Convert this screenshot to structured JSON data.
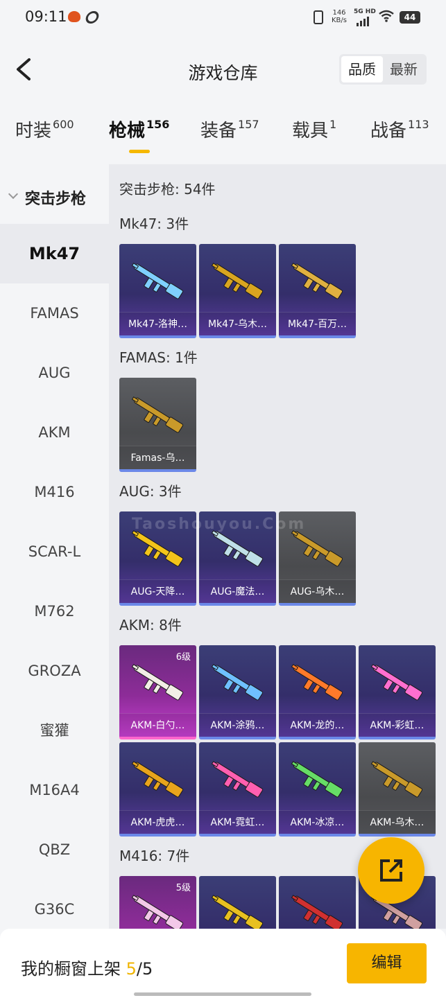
{
  "status_bar": {
    "time": "09:11",
    "speed_value": "146",
    "speed_unit": "KB/s",
    "network": "5G HD",
    "battery": "44"
  },
  "header": {
    "title": "游戏仓库",
    "sort_options": [
      "品质",
      "最新"
    ],
    "sort_active": "品质"
  },
  "tabs": [
    {
      "label": "时装",
      "count": "600"
    },
    {
      "label": "枪械",
      "count": "156"
    },
    {
      "label": "装备",
      "count": "157"
    },
    {
      "label": "载具",
      "count": "1"
    },
    {
      "label": "战备",
      "count": "113"
    }
  ],
  "sidebar": {
    "group": "突击步枪",
    "items": [
      "Mk47",
      "FAMAS",
      "AUG",
      "AKM",
      "M416",
      "SCAR-L",
      "M762",
      "GROZA",
      "蜜獾",
      "M16A4",
      "QBZ",
      "G36C"
    ],
    "active": "Mk47"
  },
  "content": {
    "summary": "突击步枪: 54件",
    "sections": [
      {
        "title": "Mk47: 3件",
        "items": [
          {
            "name": "Mk47-洛神…",
            "rarity": "purple",
            "gun_color": "#7fd0ff"
          },
          {
            "name": "Mk47-乌木…",
            "rarity": "purple",
            "gun_color": "#d9a520"
          },
          {
            "name": "Mk47-百万…",
            "rarity": "purple",
            "gun_color": "#e0b040"
          }
        ]
      },
      {
        "title": "FAMAS: 1件",
        "items": [
          {
            "name": "Famas-乌…",
            "rarity": "gray",
            "gun_color": "#c99a2a"
          }
        ]
      },
      {
        "title": "AUG: 3件",
        "items": [
          {
            "name": "AUG-天降…",
            "rarity": "purple",
            "gun_color": "#f3c41a"
          },
          {
            "name": "AUG-魔法…",
            "rarity": "purple",
            "gun_color": "#bfe0e8"
          },
          {
            "name": "AUG-乌木…",
            "rarity": "gray",
            "gun_color": "#c99a2a"
          }
        ]
      },
      {
        "title": "AKM: 8件",
        "items": [
          {
            "name": "AKM-白勺…",
            "rarity": "pink",
            "level": "6级",
            "gun_color": "#f2eee6"
          },
          {
            "name": "AKM-涂鸦…",
            "rarity": "purple",
            "gun_color": "#6fc0ff"
          },
          {
            "name": "AKM-龙的…",
            "rarity": "purple",
            "gun_color": "#ff7a2a"
          },
          {
            "name": "AKM-彩虹…",
            "rarity": "purple",
            "gun_color": "#ff6fd0"
          },
          {
            "name": "AKM-虎虎…",
            "rarity": "purple",
            "gun_color": "#e8a41c"
          },
          {
            "name": "AKM-霓虹…",
            "rarity": "purple",
            "gun_color": "#ff5fb0"
          },
          {
            "name": "AKM-冰凉…",
            "rarity": "purple",
            "gun_color": "#66dd66"
          },
          {
            "name": "AKM-乌木…",
            "rarity": "gray",
            "gun_color": "#c99a2a"
          }
        ]
      },
      {
        "title": "M416: 7件",
        "items": [
          {
            "name": "",
            "rarity": "pink",
            "level": "5级",
            "gun_color": "#f3c8e8"
          },
          {
            "name": "",
            "rarity": "purple",
            "gun_color": "#e8c020"
          },
          {
            "name": "",
            "rarity": "purple",
            "gun_color": "#d03030"
          },
          {
            "name": "",
            "rarity": "purple",
            "gun_color": "#d0a0a0"
          }
        ]
      }
    ]
  },
  "watermark": "Taoshouyou.Com",
  "bottom_bar": {
    "label": "我的橱窗上架",
    "current": "5",
    "total": "/5",
    "edit_label": "编辑"
  },
  "colors": {
    "accent": "#f7b500",
    "purple_card": "#342e6a",
    "pink_card": "#8d2c98",
    "gray_card": "#4a4b4e"
  }
}
